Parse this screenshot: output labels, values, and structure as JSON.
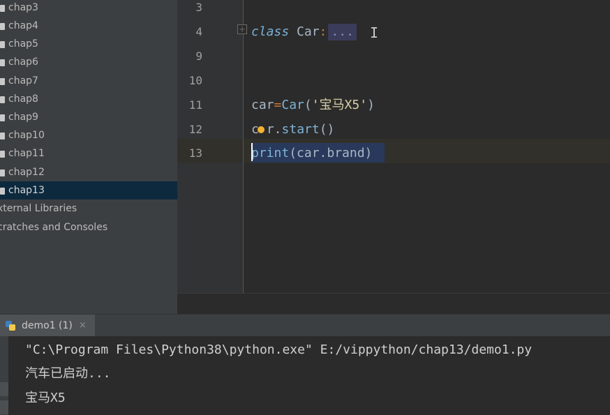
{
  "project_tree": {
    "items": [
      {
        "label": "chap3",
        "selected": false
      },
      {
        "label": "chap4",
        "selected": false
      },
      {
        "label": "chap5",
        "selected": false
      },
      {
        "label": "chap6",
        "selected": false
      },
      {
        "label": "chap7",
        "selected": false
      },
      {
        "label": "chap8",
        "selected": false
      },
      {
        "label": "chap9",
        "selected": false
      },
      {
        "label": "chap10",
        "selected": false
      },
      {
        "label": "chap11",
        "selected": false
      },
      {
        "label": "chap12",
        "selected": false
      },
      {
        "label": "chap13",
        "selected": true
      }
    ],
    "external_libraries": "xternal Libraries",
    "scratches": "cratches and Consoles"
  },
  "editor": {
    "line_numbers": [
      "3",
      "4",
      "9",
      "10",
      "11",
      "12",
      "13"
    ],
    "line4": {
      "keyword": "class",
      "name": " Car",
      "colon": ":",
      "folded": "..."
    },
    "line11": {
      "var": "car",
      "op": "=",
      "cls": "Car",
      "open": "(",
      "str": "'宝马X5'",
      "close": ")"
    },
    "line12": {
      "c": "c",
      "rest": "r.",
      "method": "start",
      "args": "()"
    },
    "line13": {
      "func": "print",
      "args": "(car.brand)"
    },
    "fold_icon": "+",
    "cursor_icon": "I"
  },
  "run_panel": {
    "tab_label": "demo1 (1)",
    "close_icon": "×",
    "output": [
      "\"C:\\Program Files\\Python38\\python.exe\" E:/vippython/chap13/demo1.py",
      "汽车已启动...",
      "宝马X5"
    ]
  },
  "colors": {
    "sidebar_bg": "#3c3f41",
    "editor_bg": "#2b2b2b",
    "selection": "#0d293e",
    "keyword": "#7ab2d8",
    "operator": "#cc7832"
  }
}
